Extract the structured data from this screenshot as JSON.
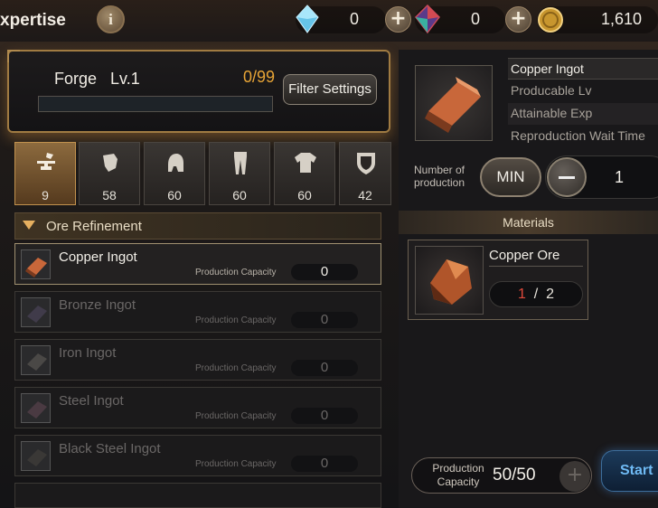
{
  "header": {
    "title": "xpertise",
    "info_label": "i",
    "crystal_blue": "0",
    "crystal_red": "0",
    "gold": "1,610",
    "plus": "+"
  },
  "forge": {
    "name": "Forge",
    "level": "Lv.1",
    "progress_text": "0/99",
    "progress": 0,
    "filter_label": "Filter Settings"
  },
  "tabs": [
    {
      "icon": "anvil-icon",
      "count": "9"
    },
    {
      "icon": "gauntlet-icon",
      "count": "58"
    },
    {
      "icon": "helmet-icon",
      "count": "60"
    },
    {
      "icon": "leg-armor-icon",
      "count": "60"
    },
    {
      "icon": "chest-armor-icon",
      "count": "60"
    },
    {
      "icon": "shield-icon",
      "count": "42"
    }
  ],
  "category": {
    "label": "Ore Refinement"
  },
  "recipes": [
    {
      "name": "Copper Ingot",
      "capacity_label": "Production Capacity",
      "capacity": "0"
    },
    {
      "name": "Bronze Ingot",
      "capacity_label": "Production Capacity",
      "capacity": "0"
    },
    {
      "name": "Iron Ingot",
      "capacity_label": "Production Capacity",
      "capacity": "0"
    },
    {
      "name": "Steel Ingot",
      "capacity_label": "Production Capacity",
      "capacity": "0"
    },
    {
      "name": "Black Steel Ingot",
      "capacity_label": "Production Capacity",
      "capacity": "0"
    }
  ],
  "detail": {
    "name": "Copper Ingot",
    "lv_label": "Producable Lv",
    "exp_label": "Attainable Exp",
    "wait_label": "Reproduction Wait Time"
  },
  "production": {
    "number_label": "Number of production",
    "min_label": "MIN",
    "minus": "−",
    "quantity": "1"
  },
  "materials": {
    "header": "Materials",
    "item": "Copper Ore",
    "have": "1",
    "sep": "/",
    "need": "2"
  },
  "capacity": {
    "label": "Production Capacity",
    "value": "50/50",
    "plus": "+"
  },
  "start_label": "Start",
  "colors": {
    "accent": "#e8a536",
    "highlight": "#c2924e",
    "shortage": "#e04a3c",
    "start": "#6fbaf4"
  }
}
